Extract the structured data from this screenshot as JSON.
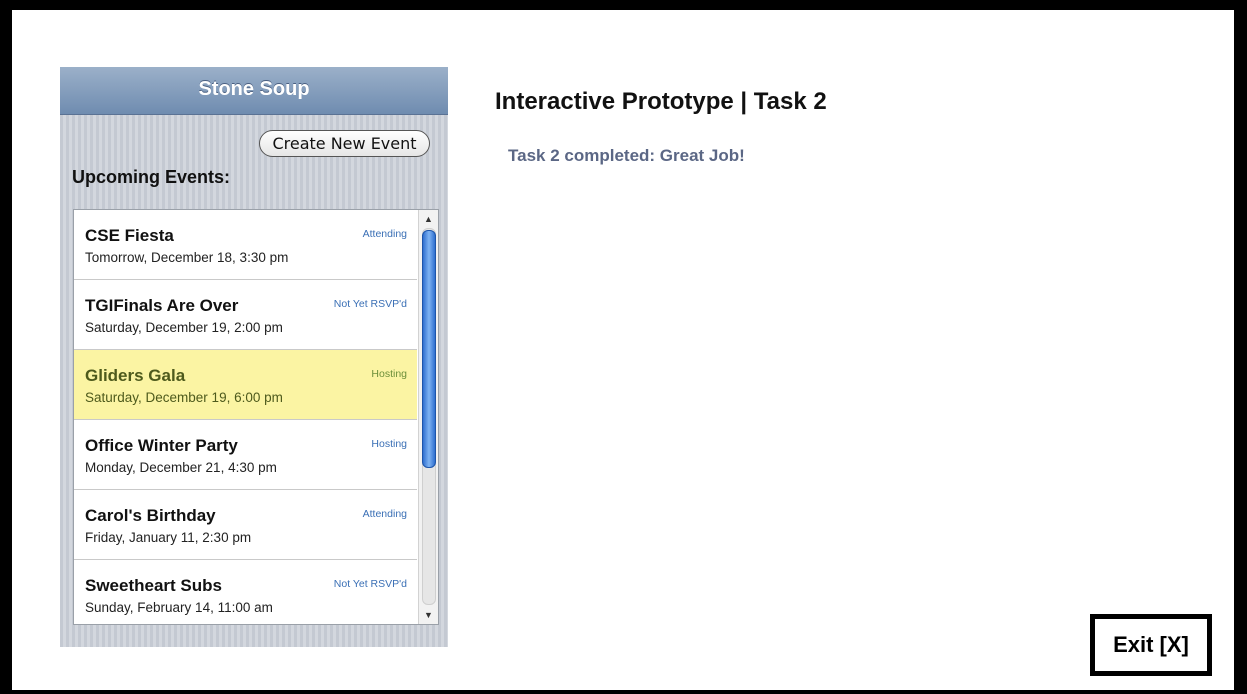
{
  "app": {
    "title": "Stone Soup"
  },
  "toolbar": {
    "create_label": "Create New Event"
  },
  "list_heading": "Upcoming Events:",
  "events": [
    {
      "title": "CSE Fiesta",
      "date": "Tomorrow, December 18, 3:30 pm",
      "status": "Attending",
      "selected": false
    },
    {
      "title": "TGIFinals Are Over",
      "date": "Saturday, December 19, 2:00 pm",
      "status": "Not Yet RSVP'd",
      "selected": false
    },
    {
      "title": "Gliders Gala",
      "date": "Saturday, December 19, 6:00 pm",
      "status": "Hosting",
      "selected": true
    },
    {
      "title": "Office Winter Party",
      "date": "Monday, December 21, 4:30 pm",
      "status": "Hosting",
      "selected": false
    },
    {
      "title": "Carol's Birthday",
      "date": "Friday, January 11, 2:30 pm",
      "status": "Attending",
      "selected": false
    },
    {
      "title": "Sweetheart Subs",
      "date": "Sunday, February 14, 11:00 am",
      "status": "Not Yet RSVP'd",
      "selected": false
    }
  ],
  "main": {
    "title": "Interactive Prototype | Task 2",
    "message": "Task 2 completed: Great Job!"
  },
  "exit_label": "Exit [X]",
  "icons": {
    "scroll_up": "scroll-up-arrow-icon",
    "scroll_down": "scroll-down-arrow-icon"
  },
  "colors": {
    "header": "#7a94b8",
    "selected_row": "#fbf4a3",
    "status_text": "#3a6fb5",
    "message_text": "#5b6785",
    "scroll_thumb": "#2f6fd0"
  }
}
